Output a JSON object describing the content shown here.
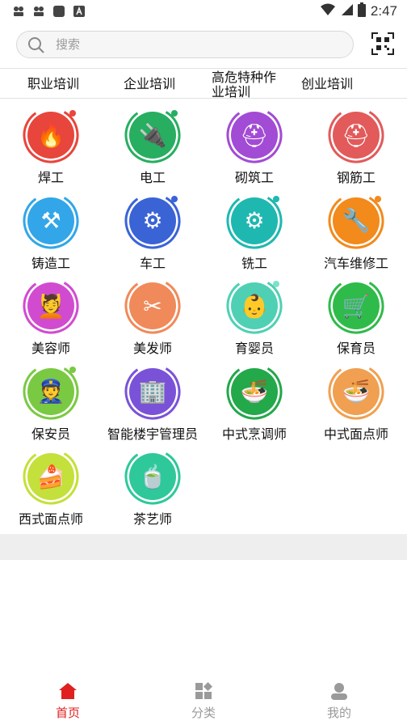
{
  "status_bar": {
    "time": "2:47",
    "left_icons": [
      "photo-icon",
      "photo-icon",
      "app-icon",
      "font-icon"
    ],
    "right_icons": [
      "wifi-icon",
      "signal-icon",
      "battery-icon"
    ]
  },
  "search": {
    "placeholder": "搜索",
    "icon": "search-icon",
    "scan_icon": "qr-scan-icon"
  },
  "tabs": [
    {
      "label": "职业培训"
    },
    {
      "label": "企业培训"
    },
    {
      "label": "高危特种作业培训"
    },
    {
      "label": "创业培训"
    }
  ],
  "categories": [
    {
      "label": "焊工",
      "color": "#e8453c",
      "dot": "#e8453c"
    },
    {
      "label": "电工",
      "color": "#27ae60",
      "dot": "#27ae60"
    },
    {
      "label": "砌筑工",
      "color": "#a24bd4",
      "dot": ""
    },
    {
      "label": "钢筋工",
      "color": "#e25a5a",
      "dot": ""
    },
    {
      "label": "铸造工",
      "color": "#32a6e8",
      "dot": ""
    },
    {
      "label": "车工",
      "color": "#3a63d6",
      "dot": "#3a63d6"
    },
    {
      "label": "铣工",
      "color": "#1fb8b0",
      "dot": "#1fb8b0"
    },
    {
      "label": "汽车维修工",
      "color": "#f28a1c",
      "dot": "#f28a1c"
    },
    {
      "label": "美容师",
      "color": "#d14bd0",
      "dot": ""
    },
    {
      "label": "美发师",
      "color": "#f08a5a",
      "dot": ""
    },
    {
      "label": "育婴员",
      "color": "#4fd0b4",
      "dot": "#7fe0c8"
    },
    {
      "label": "保育员",
      "color": "#2fbb4a",
      "dot": ""
    },
    {
      "label": "保安员",
      "color": "#7ac943",
      "dot": "#7ac943"
    },
    {
      "label": "智能楼宇管理员",
      "color": "#7a52d8",
      "dot": ""
    },
    {
      "label": "中式烹调师",
      "color": "#23a84a",
      "dot": ""
    },
    {
      "label": "中式面点师",
      "color": "#f0a050",
      "dot": ""
    },
    {
      "label": "西式面点师",
      "color": "#c4e03a",
      "dot": ""
    },
    {
      "label": "茶艺师",
      "color": "#2fc89a",
      "dot": ""
    }
  ],
  "bottom_nav": [
    {
      "label": "首页",
      "icon": "home-icon",
      "active": true
    },
    {
      "label": "分类",
      "icon": "category-icon",
      "active": false
    },
    {
      "label": "我的",
      "icon": "user-icon",
      "active": false
    }
  ],
  "colors": {
    "accent": "#e02020",
    "inactive": "#9a9a9a"
  }
}
